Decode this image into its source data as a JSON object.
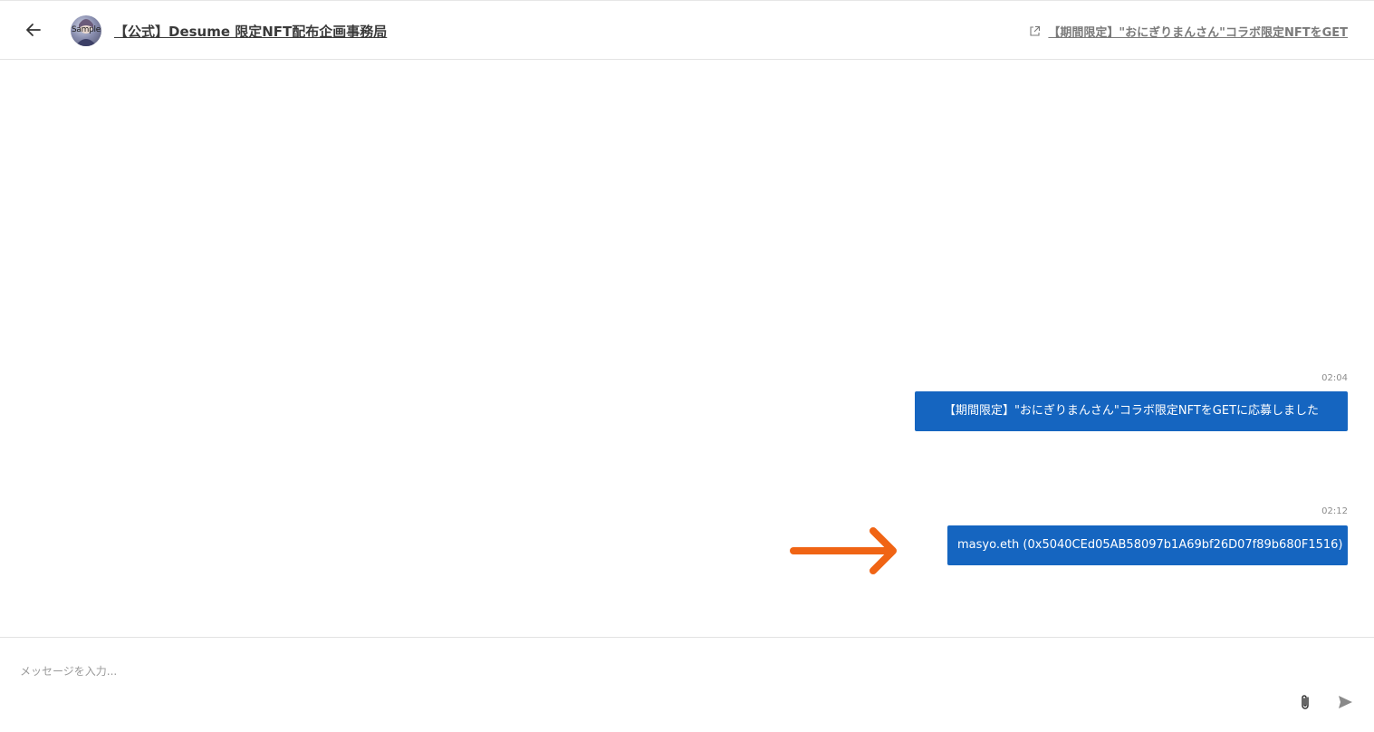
{
  "header": {
    "back_icon": "arrow-left-icon",
    "avatar_label": "Sample",
    "channel_title": "【公式】Desume 限定NFT配布企画事務局",
    "campaign_link_icon": "external-link-icon",
    "campaign_link_text": "【期間限定】\"おにぎりまんさん\"コラボ限定NFTをGET"
  },
  "messages": [
    {
      "time": "02:04",
      "text": "【期間限定】\"おにぎりまんさん\"コラボ限定NFTをGETに応募しました"
    },
    {
      "time": "02:12",
      "text": "masyo.eth (0x5040CEd05AB58097b1A69bf26D07f89b680F1516)"
    }
  ],
  "colors": {
    "bubble": "#1565c0",
    "annotation_arrow": "#f06414"
  },
  "composer": {
    "placeholder": "メッセージを入力...",
    "attach_icon": "paperclip-icon",
    "send_icon": "send-icon"
  }
}
